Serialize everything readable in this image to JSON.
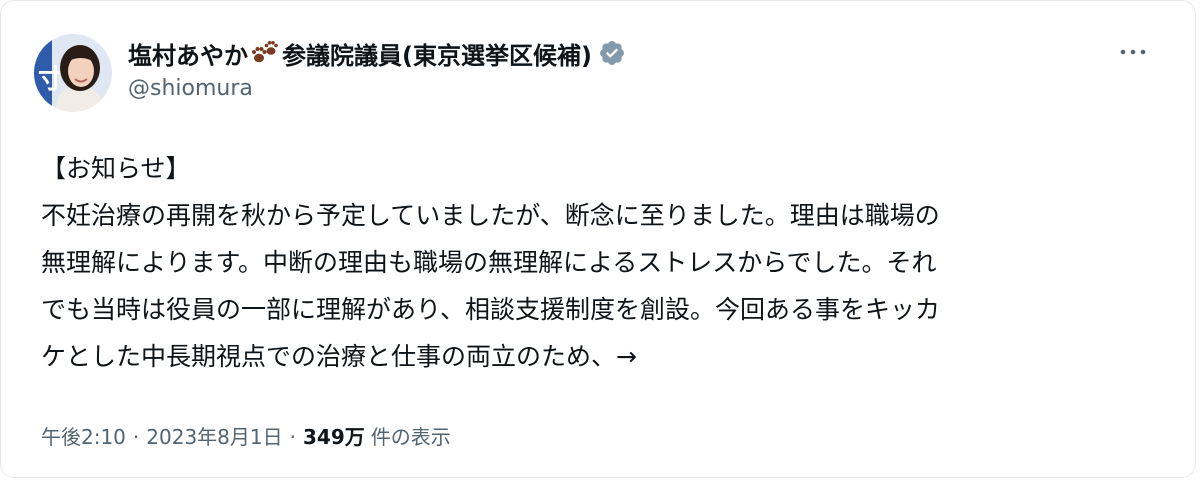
{
  "author": {
    "display_name": "塩村あやか",
    "display_name_suffix": "参議院議員(東京選挙区候補)",
    "handle": "@shiomura",
    "verified": true
  },
  "icons": {
    "name_emoji": "paw-prints-icon",
    "badge": "verified-badge-icon",
    "menu": "more-horizontal-icon"
  },
  "colors": {
    "text_primary": "#0f1419",
    "text_secondary": "#536471",
    "verified_badge": "#829aab",
    "paw": "#7a3b22"
  },
  "tweet": {
    "lines": [
      "【お知らせ】",
      "不妊治療の再開を秋から予定していましたが、断念に至りました。理由は職場の",
      "無理解によります。中断の理由も職場の無理解によるストレスからでした。それ",
      "でも当時は役員の一部に理解があり、相談支援制度を創設。今回ある事をキッカ",
      "ケとした中長期視点での治療と仕事の両立のため、→"
    ]
  },
  "meta": {
    "time": "午後2:10",
    "separator": "·",
    "date": "2023年8月1日",
    "views_count": "349万",
    "views_label": "件の表示"
  }
}
